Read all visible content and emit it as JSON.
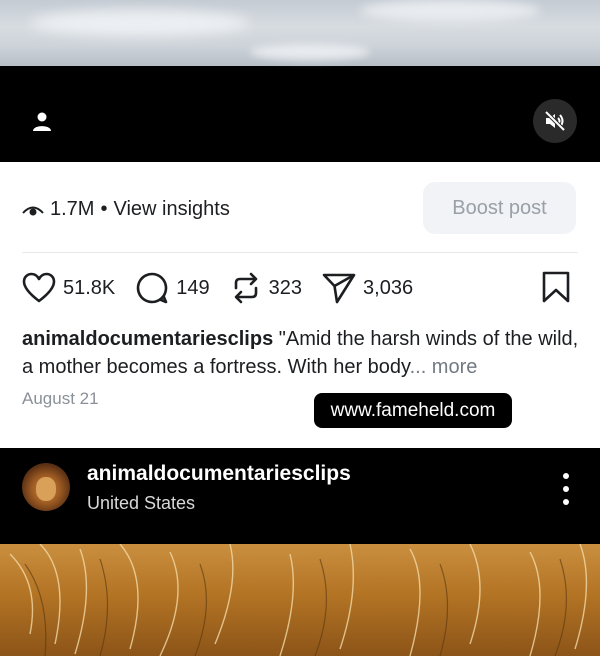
{
  "media": {
    "top_icons": [
      "person-tag-icon",
      "mute-icon"
    ],
    "bottom_subject": "lion fur close-up"
  },
  "insights": {
    "views": "1.7M",
    "separator": "•",
    "label": "View insights",
    "boost_label": "Boost post"
  },
  "actions": {
    "likes": "51.8K",
    "comments": "149",
    "reposts": "323",
    "shares": "3,036"
  },
  "caption": {
    "username": "animaldocumentariesclips",
    "text": " \"Amid the harsh winds of the wild, a mother becomes a fortress. With her body",
    "more": "... more",
    "date": "August 21"
  },
  "watermark": "www.fameheld.com",
  "next_post": {
    "username": "animaldocumentariesclips",
    "location": "United States"
  },
  "colors": {
    "text": "#1c1e21",
    "muted": "#8a9098",
    "boost_bg": "#f1f3f6",
    "boost_text": "#9aa0a8"
  }
}
